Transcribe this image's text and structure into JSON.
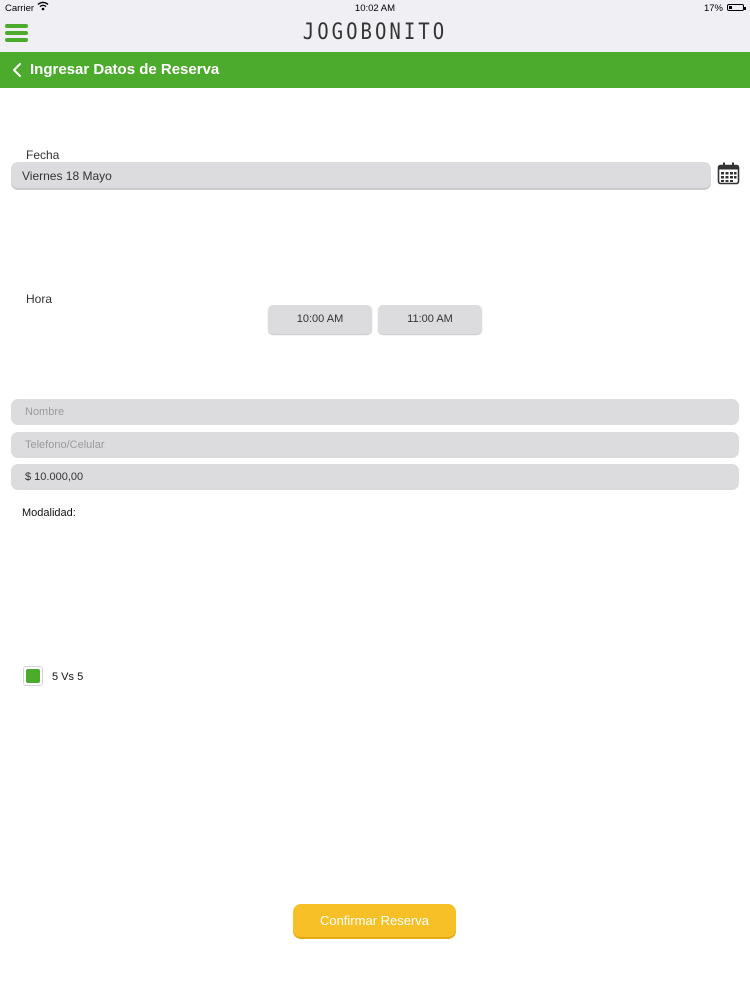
{
  "status_bar": {
    "carrier": "Carrier",
    "time": "10:02 AM",
    "battery": "17%"
  },
  "header": {
    "logo": "JOGOBONITO"
  },
  "nav": {
    "title": "Ingresar Datos de Reserva"
  },
  "form": {
    "fecha_label": "Fecha",
    "fecha_value": "Viernes 18 Mayo",
    "hora_label": "Hora",
    "time_slots": [
      "10:00 AM",
      "11:00 AM"
    ],
    "nombre_placeholder": "Nombre",
    "telefono_placeholder": "Telefono/Celular",
    "price": "$ 10.000,00",
    "modalidad_label": "Modalidad:",
    "modalidad_option": "5 Vs 5"
  },
  "actions": {
    "confirm_label": "Confirmar Reserva"
  },
  "colors": {
    "brand_green": "#4caa2c",
    "confirm_yellow": "#f6c026",
    "field_gray": "#dcdcdf"
  }
}
